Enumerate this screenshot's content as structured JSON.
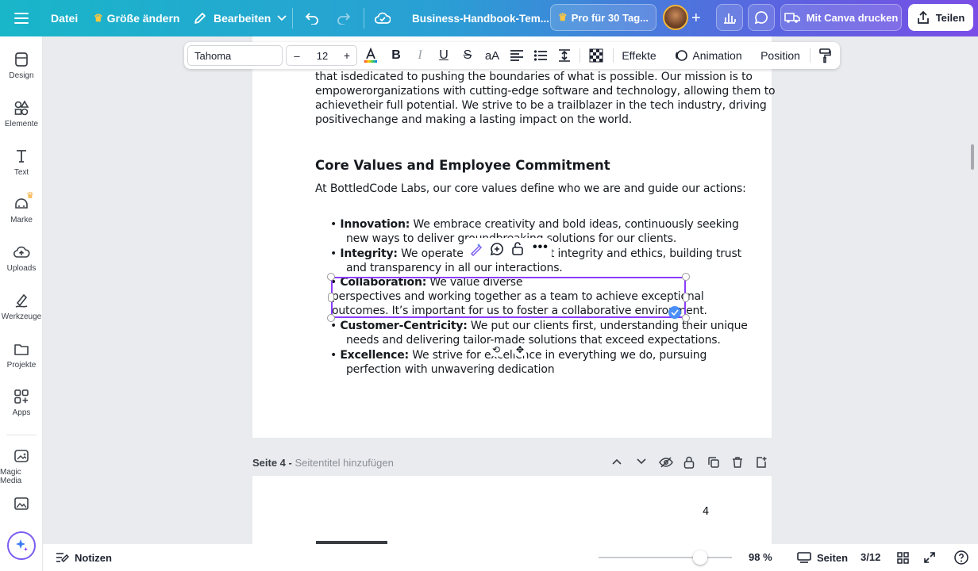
{
  "topbar": {
    "menu_icon": "hamburger-icon",
    "file_label": "Datei",
    "resize_label": "Größe ändern",
    "edit_label": "Bearbeiten",
    "doc_title": "Business-Handbook-Tem...",
    "pro_label": "Pro für 30 Tag...",
    "print_label": "Mit Canva drucken",
    "share_label": "Teilen"
  },
  "sidebar": {
    "items": [
      {
        "label": "Design",
        "icon": "layout-icon"
      },
      {
        "label": "Elemente",
        "icon": "shapes-icon"
      },
      {
        "label": "Text",
        "icon": "text-icon"
      },
      {
        "label": "Marke",
        "icon": "brand-icon"
      },
      {
        "label": "Uploads",
        "icon": "cloud-upload-icon"
      },
      {
        "label": "Werkzeuge",
        "icon": "draw-icon"
      },
      {
        "label": "Projekte",
        "icon": "folder-icon"
      },
      {
        "label": "Apps",
        "icon": "apps-icon"
      },
      {
        "label": "Magic Media",
        "icon": "magic-media-icon"
      }
    ]
  },
  "format_toolbar": {
    "font": "Tahoma",
    "font_size": "12",
    "minus": "–",
    "plus": "+",
    "case_label": "aA",
    "effects_label": "Effekte",
    "animation_label": "Animation",
    "position_label": "Position"
  },
  "document": {
    "intro_lines": [
      "that isdedicated to pushing the boundaries of what is possible. Our mission is to",
      "empowerorganizations with cutting-edge software and technology, allowing them to",
      "achievetheir full potential. We strive to be a trailblazer in the tech industry, driving",
      "positivechange and making a lasting impact on the world."
    ],
    "heading": "Core Values and Employee Commitment",
    "lead": "At BottledCode Labs, our core values define who we are and guide our actions:",
    "bullets": [
      {
        "line1_bold": "Innovation:",
        "line1_rest": " We embrace creativity and bold ideas, continuously seeking",
        "line2": "new ways to deliver groundbreaking solutions for our clients."
      },
      {
        "line1_bold": "Integrity:",
        "line1_rest": " We operate with the highest integrity and ethics, building trust",
        "line2": "and transparency in all our interactions."
      },
      {
        "line1_bold": "Collaboration:",
        "line1_rest": " We value diverse",
        "line2": "perspectives and working together as a team to achieve exceptional",
        "line3": "outcomes. It’s important for us to foster a collaborative environment."
      },
      {
        "line1_bold": "Customer-Centricity:",
        "line1_rest": " We put our clients first, understanding their unique",
        "line2": "needs and delivering tailor-made solutions that exceed expectations."
      },
      {
        "line1_bold": "Excellence:",
        "line1_rest": " We strive for excellence in everything we do, pursuing",
        "line2": "perfection with unwavering dedication"
      }
    ]
  },
  "page4": {
    "label": "Seite 4 -",
    "title_placeholder": "Seitentitel hinzufügen",
    "page_number": "4"
  },
  "bottombar": {
    "notes_label": "Notizen",
    "zoom": "98 %",
    "pages_label": "Seiten",
    "page_count": "3/12",
    "zoom_level": 0.98
  },
  "colors": {
    "accent": "#8b3dff",
    "selection": "#8b3dff",
    "check": "#4a8ff7"
  }
}
